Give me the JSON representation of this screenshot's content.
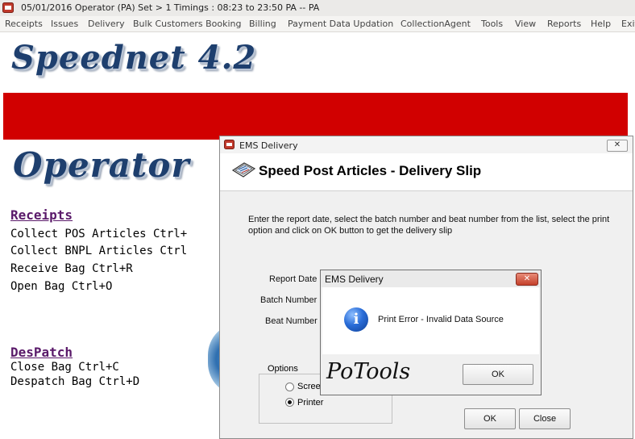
{
  "titlebar": {
    "icon": "app-icon",
    "title": "05/01/2016    Operator (PA)  Set > 1 Timings : 08:23  to  23:50    PA -- PA"
  },
  "menubar": {
    "items": [
      "Receipts",
      "Issues",
      "Delivery",
      "Bulk Customers Booking",
      "Billing",
      "Payment Data Updation",
      "CollectionAgent",
      "Tools",
      "View",
      "Reports",
      "Help",
      "Exit"
    ]
  },
  "branding": {
    "product_logo": "Speednet 4.2",
    "role_logo": "Operator",
    "band_color": "#d10000"
  },
  "left_menu": {
    "receipts": {
      "heading": "Receipts",
      "items": [
        "Collect POS Articles Ctrl+",
        "Collect BNPL Articles Ctrl",
        "Receive Bag Ctrl+R",
        "Open Bag  Ctrl+O"
      ]
    },
    "despatch": {
      "heading": "DesPatch",
      "items": [
        "Close Bag  Ctrl+C",
        "Despatch Bag  Ctrl+D"
      ]
    }
  },
  "ems_window": {
    "title": "EMS Delivery",
    "close_label": "✕",
    "header_title": "Speed Post Articles - Delivery Slip",
    "instructions": "Enter the report date, select the batch number and beat number from the list, select the print option and click on OK button to get the delivery slip",
    "fields": {
      "report_date_label": "Report Date",
      "batch_number_label": "Batch Number",
      "beat_number_label": "Beat Number"
    },
    "options": {
      "title": "Options",
      "screen_label": "Scree",
      "printer_label": "Printer",
      "selected": "Printer"
    },
    "ok_label": "OK",
    "close_button_label": "Close"
  },
  "message_dialog": {
    "title": "EMS Delivery",
    "close_label": "✕",
    "icon": "info-icon",
    "message": "Print Error - Invalid Data Source",
    "watermark": "PoTools",
    "ok_label": "OK"
  }
}
